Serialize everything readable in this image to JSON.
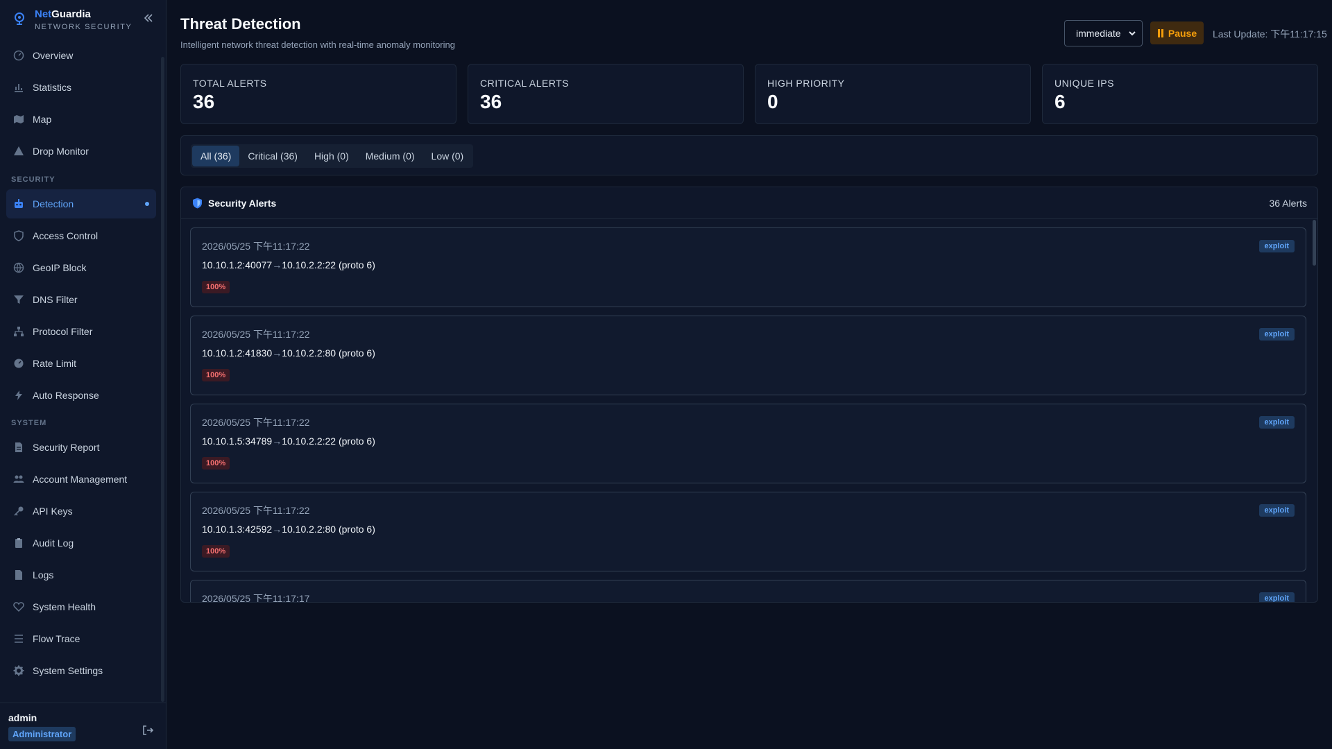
{
  "brand": {
    "name_accent": "Net",
    "name_rest": "Guardia",
    "subtitle": "NETWORK SECURITY"
  },
  "nav": {
    "items_top": [
      {
        "label": "Overview",
        "icon": "gauge-icon"
      },
      {
        "label": "Statistics",
        "icon": "bar-chart-icon"
      },
      {
        "label": "Map",
        "icon": "map-icon"
      },
      {
        "label": "Drop Monitor",
        "icon": "warning-icon"
      }
    ],
    "section_security": "SECURITY",
    "items_security": [
      {
        "label": "Detection",
        "icon": "robot-icon"
      },
      {
        "label": "Access Control",
        "icon": "shield-icon"
      },
      {
        "label": "GeoIP Block",
        "icon": "globe-icon"
      },
      {
        "label": "DNS Filter",
        "icon": "filter-icon"
      },
      {
        "label": "Protocol Filter",
        "icon": "sitemap-icon"
      },
      {
        "label": "Rate Limit",
        "icon": "gauge-icon"
      },
      {
        "label": "Auto Response",
        "icon": "bolt-icon"
      }
    ],
    "section_system": "SYSTEM",
    "items_system": [
      {
        "label": "Security Report",
        "icon": "document-icon"
      },
      {
        "label": "Account Management",
        "icon": "users-icon"
      },
      {
        "label": "API Keys",
        "icon": "key-icon"
      },
      {
        "label": "Audit Log",
        "icon": "clipboard-icon"
      },
      {
        "label": "Logs",
        "icon": "file-icon"
      },
      {
        "label": "System Health",
        "icon": "heart-pulse-icon"
      },
      {
        "label": "Flow Trace",
        "icon": "list-icon"
      },
      {
        "label": "System Settings",
        "icon": "gear-icon"
      }
    ],
    "active": "Detection"
  },
  "user": {
    "name": "admin",
    "role": "Administrator"
  },
  "header": {
    "title": "Threat Detection",
    "subtitle": "Intelligent network threat detection with real-time anomaly monitoring",
    "mode_value": "immediate",
    "pause_label": "Pause",
    "last_update": "Last Update: 下午11:17:15"
  },
  "stats": [
    {
      "label": "TOTAL ALERTS",
      "value": "36"
    },
    {
      "label": "CRITICAL ALERTS",
      "value": "36"
    },
    {
      "label": "HIGH PRIORITY",
      "value": "0"
    },
    {
      "label": "UNIQUE IPS",
      "value": "6"
    }
  ],
  "filters": [
    {
      "label": "All (36)",
      "active": true
    },
    {
      "label": "Critical (36)",
      "active": false
    },
    {
      "label": "High (0)",
      "active": false
    },
    {
      "label": "Medium (0)",
      "active": false
    },
    {
      "label": "Low (0)",
      "active": false
    }
  ],
  "alerts_panel": {
    "title": "Security Alerts",
    "count": "36 Alerts",
    "alerts": [
      {
        "time": "2026/05/25 下午11:17:22",
        "src": "10.10.1.2:40077",
        "arrow": "→",
        "dst": "10.10.2.2:22 (proto 6)",
        "confidence": "100%",
        "tag": "exploit"
      },
      {
        "time": "2026/05/25 下午11:17:22",
        "src": "10.10.1.2:41830",
        "arrow": "→",
        "dst": "10.10.2.2:80 (proto 6)",
        "confidence": "100%",
        "tag": "exploit"
      },
      {
        "time": "2026/05/25 下午11:17:22",
        "src": "10.10.1.5:34789",
        "arrow": "→",
        "dst": "10.10.2.2:22 (proto 6)",
        "confidence": "100%",
        "tag": "exploit"
      },
      {
        "time": "2026/05/25 下午11:17:22",
        "src": "10.10.1.3:42592",
        "arrow": "→",
        "dst": "10.10.2.2:80 (proto 6)",
        "confidence": "100%",
        "tag": "exploit"
      },
      {
        "time": "2026/05/25 下午11:17:17",
        "src": "",
        "arrow": "",
        "dst": "",
        "confidence": "",
        "tag": "exploit"
      }
    ]
  },
  "colors": {
    "accent": "#3b82f6",
    "critical": "#f87171",
    "warning": "#f59e0b",
    "background": "#0b1120"
  }
}
